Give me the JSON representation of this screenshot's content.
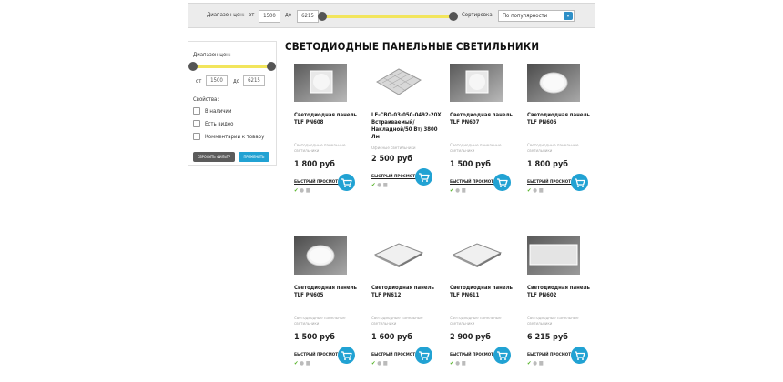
{
  "topbar": {
    "price_label": "Диапазон цен:",
    "from_label": "от",
    "from_value": "1500",
    "to_label": "до",
    "to_value": "6215",
    "sort_label": "Сортировка:",
    "sort_value": "По популярности"
  },
  "sidebar": {
    "price_label": "Диапазон цен:",
    "from_label": "от",
    "from_value": "1500",
    "to_label": "до",
    "to_value": "6215",
    "props_label": "Свойства:",
    "checkboxes": [
      "В наличии",
      "Есть видео",
      "Комментарии к товару"
    ],
    "reset_label": "СБРОСИТЬ ФИЛЬТР",
    "apply_label": "ПРИМЕНИТЬ"
  },
  "page_title": "СВЕТОДИОДНЫЕ ПАНЕЛЬНЫЕ СВЕТИЛЬНИКИ",
  "quick_view": "БЫСТРЫЙ ПРОСМОТР",
  "products": [
    {
      "name": "Светодиодная панель TLF PN608",
      "category": "Светодиодные панельные светильники",
      "price": "1 800 руб",
      "image": "square-panel-circle"
    },
    {
      "name": "LE-CBO-03-050-0492-20Х Встраиваемый/ Накладной/50 Вт/ 3800 Лм",
      "category": "Офисные светильники",
      "price": "2 500 руб",
      "image": "grid-office-light"
    },
    {
      "name": "Светодиодная панель TLF PN607",
      "category": "Светодиодные панельные светильники",
      "price": "1 500 руб",
      "image": "square-panel-circle"
    },
    {
      "name": "Светодиодная панель TLF PN606",
      "category": "Светодиодные панельные светильники",
      "price": "1 800 руб",
      "image": "round-panel"
    },
    {
      "name": "Светодиодная панель TLF PN605",
      "category": "Светодиодные панельные светильники",
      "price": "1 500 руб",
      "image": "round-panel"
    },
    {
      "name": "Светодиодная панель TLF PN612",
      "category": "Светодиодные панельные светильники",
      "price": "1 600 руб",
      "image": "flat-square-panel"
    },
    {
      "name": "Светодиодная панель TLF PN611",
      "category": "Светодиодные панельные светильники",
      "price": "2 900 руб",
      "image": "flat-square-panel"
    },
    {
      "name": "Светодиодная панель TLF PN602",
      "category": "Светодиодные панельные светильники",
      "price": "6 215 руб",
      "image": "wide-rect-panel"
    }
  ]
}
